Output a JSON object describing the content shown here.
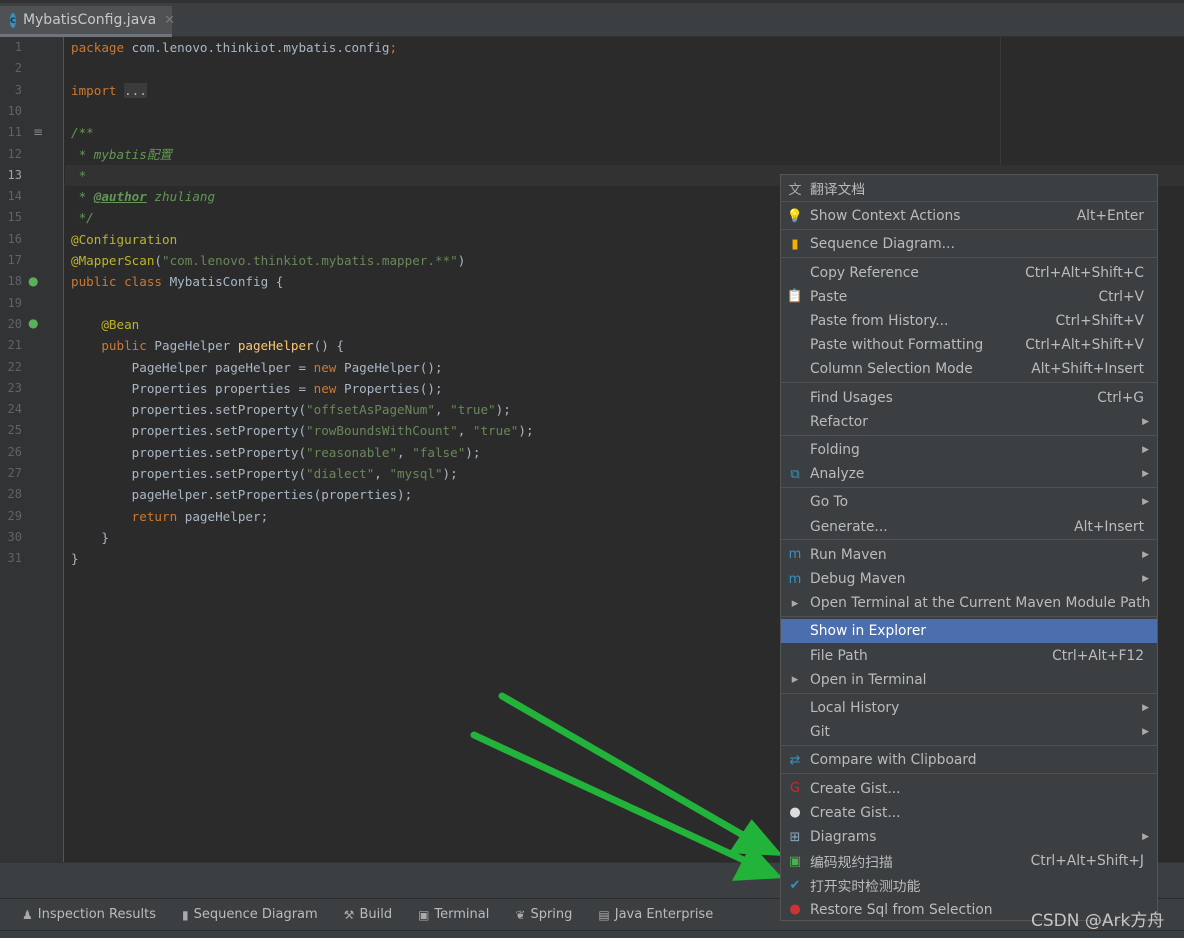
{
  "tab": {
    "label": "MybatisConfig.java",
    "icon": "java-class-icon"
  },
  "code": [
    {
      "n": "1",
      "t": [
        [
          "package ",
          "kw"
        ],
        [
          "com.lenovo.thinkiot.mybatis.config",
          "pl"
        ],
        [
          ";",
          "kw"
        ]
      ]
    },
    {
      "n": "2",
      "t": []
    },
    {
      "n": "3",
      "t": [
        [
          "import ",
          "kw"
        ],
        [
          "...",
          "fold"
        ]
      ]
    },
    {
      "n": "10",
      "t": []
    },
    {
      "n": "11",
      "t": [
        [
          "/**",
          "cm"
        ]
      ]
    },
    {
      "n": "12",
      "t": [
        [
          " * mybatis配置",
          "cm"
        ]
      ]
    },
    {
      "n": "13",
      "t": [
        [
          " *",
          "cm"
        ]
      ],
      "current": true
    },
    {
      "n": "14",
      "t": [
        [
          " * ",
          "cm"
        ],
        [
          "@author",
          "tg"
        ],
        [
          " zhuliang",
          "cm"
        ]
      ]
    },
    {
      "n": "15",
      "t": [
        [
          " */",
          "cm"
        ]
      ]
    },
    {
      "n": "16",
      "t": [
        [
          "@Configuration",
          "an"
        ]
      ]
    },
    {
      "n": "17",
      "t": [
        [
          "@MapperScan",
          "an"
        ],
        [
          "(",
          "pl"
        ],
        [
          "\"com.lenovo.thinkiot.mybatis.mapper.**\"",
          "st"
        ],
        [
          ")",
          "pl"
        ]
      ]
    },
    {
      "n": "18",
      "t": [
        [
          "public class ",
          "kw"
        ],
        [
          "MybatisConfig {",
          "pl"
        ]
      ]
    },
    {
      "n": "19",
      "t": []
    },
    {
      "n": "20",
      "t": [
        [
          "    @Bean",
          "an"
        ]
      ]
    },
    {
      "n": "21",
      "t": [
        [
          "    public ",
          "kw"
        ],
        [
          "PageHelper ",
          "pl"
        ],
        [
          "pageHelper",
          "fn"
        ],
        [
          "() {",
          "pl"
        ]
      ]
    },
    {
      "n": "22",
      "t": [
        [
          "        PageHelper pageHelper = ",
          "pl"
        ],
        [
          "new ",
          "kw"
        ],
        [
          "PageHelper();",
          "pl"
        ]
      ]
    },
    {
      "n": "23",
      "t": [
        [
          "        Properties properties = ",
          "pl"
        ],
        [
          "new ",
          "kw"
        ],
        [
          "Properties();",
          "pl"
        ]
      ]
    },
    {
      "n": "24",
      "t": [
        [
          "        properties.setProperty(",
          "pl"
        ],
        [
          "\"offsetAsPageNum\"",
          "st"
        ],
        [
          ", ",
          "pl"
        ],
        [
          "\"true\"",
          "st"
        ],
        [
          ");",
          "pl"
        ]
      ]
    },
    {
      "n": "25",
      "t": [
        [
          "        properties.setProperty(",
          "pl"
        ],
        [
          "\"rowBoundsWithCount\"",
          "st"
        ],
        [
          ", ",
          "pl"
        ],
        [
          "\"true\"",
          "st"
        ],
        [
          ");",
          "pl"
        ]
      ]
    },
    {
      "n": "26",
      "t": [
        [
          "        properties.setProperty(",
          "pl"
        ],
        [
          "\"reasonable\"",
          "st"
        ],
        [
          ", ",
          "pl"
        ],
        [
          "\"false\"",
          "st"
        ],
        [
          ");",
          "pl"
        ]
      ]
    },
    {
      "n": "27",
      "t": [
        [
          "        properties.setProperty(",
          "pl"
        ],
        [
          "\"dialect\"",
          "st"
        ],
        [
          ", ",
          "pl"
        ],
        [
          "\"mysql\"",
          "st"
        ],
        [
          ");",
          "pl"
        ]
      ]
    },
    {
      "n": "28",
      "t": [
        [
          "        pageHelper.setProperties(properties);",
          "pl"
        ]
      ]
    },
    {
      "n": "29",
      "t": [
        [
          "        ",
          "pl"
        ],
        [
          "return ",
          "kw"
        ],
        [
          "pageHelper;",
          "pl"
        ]
      ]
    },
    {
      "n": "30",
      "t": [
        [
          "    }",
          "pl"
        ]
      ]
    },
    {
      "n": "31",
      "t": [
        [
          "}",
          "pl"
        ]
      ]
    }
  ],
  "menu": [
    {
      "label": "翻译文档",
      "icon": "translate-icon",
      "glyph": "文"
    },
    {
      "sep": true
    },
    {
      "label": "Show Context Actions",
      "shortcut": "Alt+Enter",
      "icon": "lightbulb-icon",
      "glyph": "💡"
    },
    {
      "sep": true
    },
    {
      "label": "Sequence Diagram...",
      "icon": "sequence-diagram-icon",
      "glyph": "▮",
      "color": "#f0b400"
    },
    {
      "sep": true
    },
    {
      "label": "Copy Reference",
      "shortcut": "Ctrl+Alt+Shift+C"
    },
    {
      "label": "Paste",
      "shortcut": "Ctrl+V",
      "icon": "clipboard-icon",
      "glyph": "📋"
    },
    {
      "label": "Paste from History...",
      "shortcut": "Ctrl+Shift+V"
    },
    {
      "label": "Paste without Formatting",
      "shortcut": "Ctrl+Alt+Shift+V"
    },
    {
      "label": "Column Selection Mode",
      "shortcut": "Alt+Shift+Insert"
    },
    {
      "sep": true
    },
    {
      "label": "Find Usages",
      "shortcut": "Ctrl+G"
    },
    {
      "label": "Refactor",
      "submenu": true
    },
    {
      "sep": true
    },
    {
      "label": "Folding",
      "submenu": true
    },
    {
      "label": "Analyze",
      "submenu": true,
      "icon": "analyze-icon",
      "glyph": "⧉",
      "color": "#3592c4"
    },
    {
      "sep": true
    },
    {
      "label": "Go To",
      "submenu": true
    },
    {
      "label": "Generate...",
      "shortcut": "Alt+Insert"
    },
    {
      "sep": true
    },
    {
      "label": "Run Maven",
      "submenu": true,
      "icon": "maven-run-icon",
      "glyph": "m",
      "color": "#3592c4"
    },
    {
      "label": "Debug Maven",
      "submenu": true,
      "icon": "maven-debug-icon",
      "glyph": "m",
      "color": "#3592c4"
    },
    {
      "label": "Open Terminal at the Current Maven Module Path",
      "icon": "maven-terminal-icon",
      "glyph": "▸"
    },
    {
      "sep": true
    },
    {
      "label": "Show in Explorer",
      "selected": true
    },
    {
      "label": "File Path",
      "shortcut": "Ctrl+Alt+F12"
    },
    {
      "label": "Open in Terminal",
      "icon": "terminal-icon",
      "glyph": "▸"
    },
    {
      "sep": true
    },
    {
      "label": "Local History",
      "submenu": true
    },
    {
      "label": "Git",
      "submenu": true
    },
    {
      "sep": true
    },
    {
      "label": "Compare with Clipboard",
      "icon": "compare-icon",
      "glyph": "⇄",
      "color": "#3592c4"
    },
    {
      "sep": true
    },
    {
      "label": "Create Gist...",
      "icon": "gist-icon",
      "glyph": "G",
      "color": "#e02020"
    },
    {
      "label": "Create Gist...",
      "icon": "github-icon",
      "glyph": "●",
      "color": "#ddd"
    },
    {
      "label": "Diagrams",
      "submenu": true,
      "icon": "diagrams-icon",
      "glyph": "⊞",
      "color": "#8ab"
    },
    {
      "label": "编码规约扫描",
      "shortcut": "Ctrl+Alt+Shift+J",
      "icon": "code-scan-icon",
      "glyph": "▣",
      "color": "#4caf50"
    },
    {
      "label": "打开实时检测功能",
      "icon": "realtime-check-icon",
      "glyph": "✔",
      "color": "#3592c4"
    },
    {
      "label": "Restore Sql from Selection",
      "icon": "mybatis-bird-icon",
      "glyph": "●",
      "color": "#c33"
    }
  ],
  "toolwindows": [
    {
      "label": "Inspection Results",
      "icon": "inspection-icon",
      "glyph": "♟"
    },
    {
      "label": "Sequence Diagram",
      "icon": "sequence-diagram-icon",
      "glyph": "▮"
    },
    {
      "label": "Build",
      "icon": "hammer-icon",
      "glyph": "⚒"
    },
    {
      "label": "Terminal",
      "icon": "terminal-icon",
      "glyph": "▣"
    },
    {
      "label": "Spring",
      "icon": "spring-leaf-icon",
      "glyph": "❦"
    },
    {
      "label": "Java Enterprise",
      "icon": "java-enterprise-icon",
      "glyph": "▤"
    }
  ],
  "watermark": "CSDN @Ark方舟",
  "colors": {
    "selection": "#4b6eaf",
    "arrow": "#22b33a",
    "menu_bg": "#3c3f41",
    "editor_bg": "#2b2b2b"
  }
}
